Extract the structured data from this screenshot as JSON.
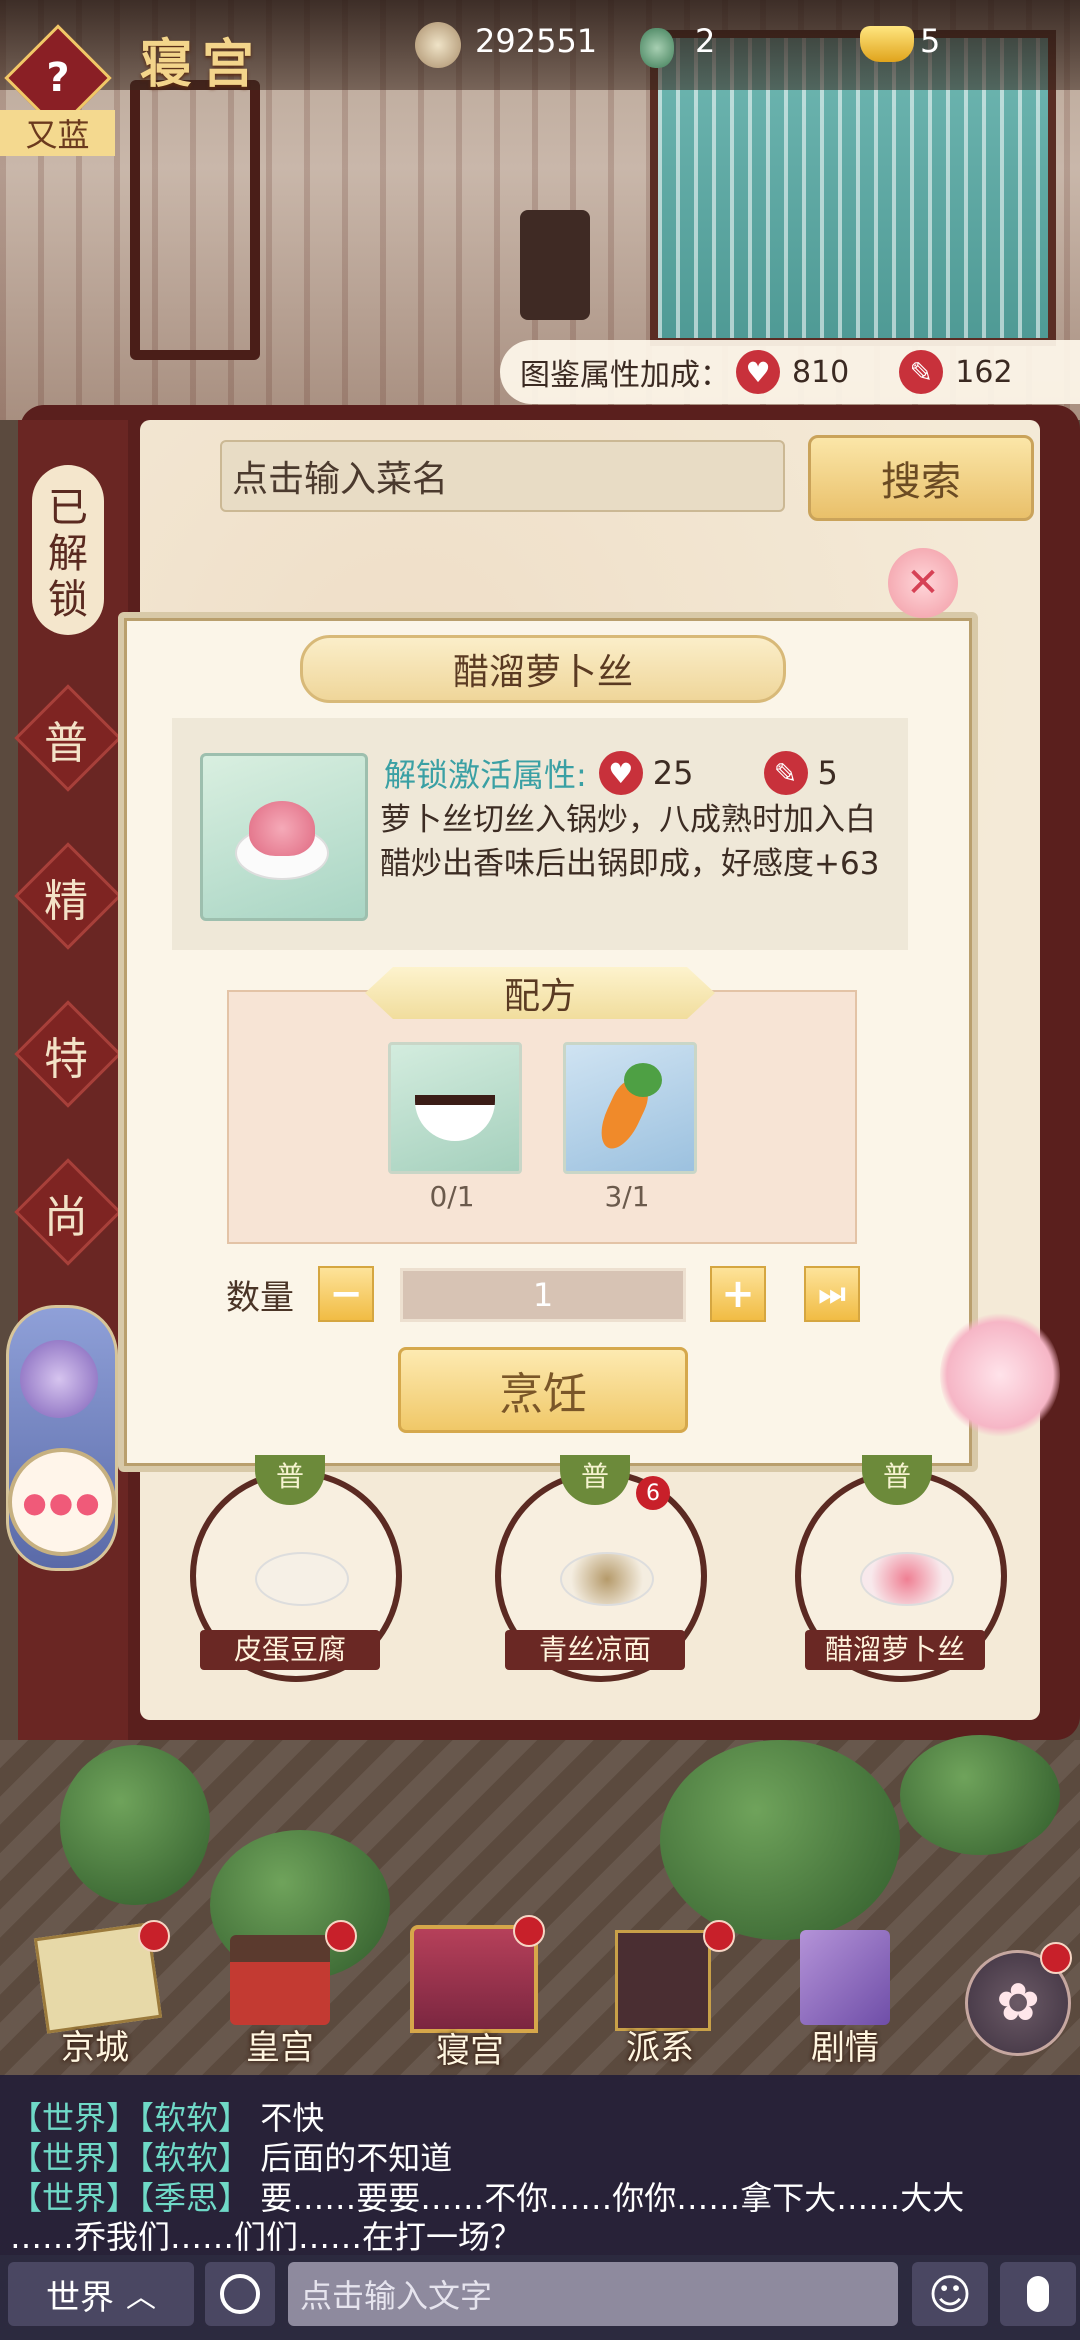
{
  "header": {
    "help_icon": "question-icon",
    "title": "寝宫",
    "left_tag": "又蓝",
    "currency_coins": "292551",
    "currency_jade": "2",
    "currency_gold": "5"
  },
  "bonus": {
    "label": "图鉴属性加成：",
    "heart_value": "810",
    "brush_value": "162"
  },
  "search": {
    "placeholder": "点击输入菜名",
    "button": "搜索"
  },
  "side_tabs": {
    "unlocked": "已解锁",
    "tab1": "普",
    "tab2": "精",
    "tab3": "特",
    "tab4": "尚"
  },
  "modal": {
    "title": "醋溜萝卜丝",
    "unlock_label": "解锁激活属性:",
    "heart_bonus": "25",
    "brush_bonus": "5",
    "description_line1": "萝卜丝切丝入锅炒，八成熟时加入白",
    "description_line2": "醋炒出香味后出锅即成，好感度+63",
    "recipe_title": "配方",
    "ingredients": [
      {
        "name": "vinegar-bowl",
        "count": "0/1"
      },
      {
        "name": "carrot",
        "count": "3/1"
      }
    ],
    "qty_label": "数量",
    "qty_minus": "−",
    "qty_value": "1",
    "qty_plus": "+",
    "qty_max": "⏭",
    "cook_button": "烹饪"
  },
  "dishes": [
    {
      "label": "皮蛋豆腐",
      "grade": "普",
      "badge": ""
    },
    {
      "label": "青丝凉面",
      "grade": "普",
      "badge": "6"
    },
    {
      "label": "醋溜萝卜丝",
      "grade": "普",
      "badge": ""
    }
  ],
  "nav": [
    {
      "label": "京城"
    },
    {
      "label": "皇宫"
    },
    {
      "label": "寝宫"
    },
    {
      "label": "派系"
    },
    {
      "label": "剧情"
    }
  ],
  "chat": {
    "lines": [
      {
        "channel": "【世界】",
        "name": "【软软】",
        "text": "不快"
      },
      {
        "channel": "【世界】",
        "name": "【软软】",
        "text": "后面的不知道"
      },
      {
        "channel": "【世界】",
        "name": "【季思】",
        "text": "要……要要……不你……你你……拿下大……大大"
      }
    ],
    "continuation": "……乔我们……们们……在打一场？",
    "channel_button": "世界",
    "input_placeholder": "点击输入文字"
  },
  "colors": {
    "accent_gold": "#f0c868",
    "panel_red": "#5a1f1d",
    "heart_red": "#c8313b",
    "chat_cyan": "#6fd9c7"
  }
}
